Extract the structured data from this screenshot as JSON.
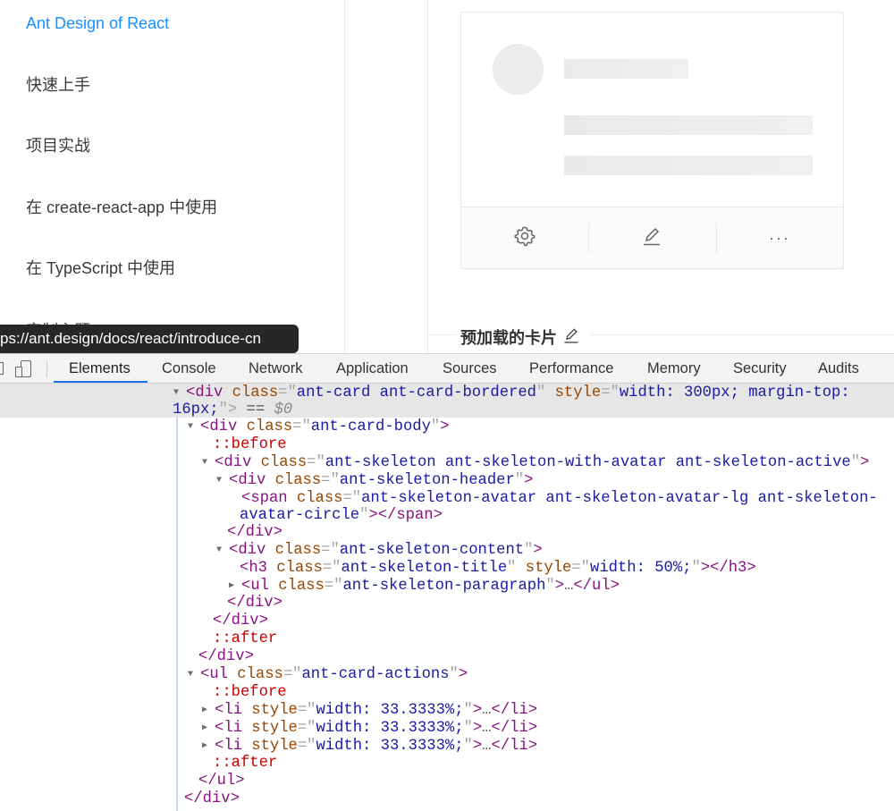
{
  "sidebar": {
    "items": [
      {
        "label": "Ant Design of React",
        "active": true
      },
      {
        "label": "快速上手"
      },
      {
        "label": "项目实战"
      },
      {
        "label": "在 create-react-app 中使用"
      },
      {
        "label": "在 TypeScript 中使用"
      },
      {
        "label": "定制主题"
      }
    ]
  },
  "tooltip": {
    "url": "ps://ant.design/docs/react/introduce-cn"
  },
  "card": {
    "actions": [
      "setting-icon",
      "edit-icon",
      "ellipsis-icon"
    ],
    "ellipsis": "···"
  },
  "section": {
    "title": "预加载的卡片"
  },
  "devtools": {
    "tabs": [
      "Elements",
      "Console",
      "Network",
      "Application",
      "Sources",
      "Performance",
      "Memory",
      "Security",
      "Audits"
    ],
    "active_tab": "Elements",
    "lines": [
      {
        "tri": "open",
        "tokens": [
          [
            "tag",
            "<div "
          ],
          [
            "attr",
            "class"
          ],
          [
            "punc",
            "=\""
          ],
          [
            "val",
            "ant-card ant-card-bordered"
          ],
          [
            "punc",
            "\" "
          ],
          [
            "attr",
            "style"
          ],
          [
            "punc",
            "=\""
          ],
          [
            "val",
            "width: 300px; margin-top:"
          ]
        ]
      },
      {
        "tokens": [
          [
            "val",
            "16px;"
          ],
          [
            "punc",
            "\">"
          ],
          [
            "plain",
            " == "
          ],
          [
            "ref",
            "$0"
          ]
        ]
      },
      {
        "tri": "open",
        "tokens": [
          [
            "tag",
            "<div "
          ],
          [
            "attr",
            "class"
          ],
          [
            "punc",
            "=\""
          ],
          [
            "val",
            "ant-card-body"
          ],
          [
            "punc",
            "\""
          ],
          [
            "tag",
            ">"
          ]
        ]
      },
      {
        "tokens": [
          [
            "pseudo",
            "::before"
          ]
        ]
      },
      {
        "tri": "open",
        "tokens": [
          [
            "tag",
            "<div "
          ],
          [
            "attr",
            "class"
          ],
          [
            "punc",
            "=\""
          ],
          [
            "val",
            "ant-skeleton ant-skeleton-with-avatar ant-skeleton-active"
          ],
          [
            "punc",
            "\""
          ],
          [
            "tag",
            ">"
          ]
        ]
      },
      {
        "tri": "open",
        "tokens": [
          [
            "tag",
            "<div "
          ],
          [
            "attr",
            "class"
          ],
          [
            "punc",
            "=\""
          ],
          [
            "val",
            "ant-skeleton-header"
          ],
          [
            "punc",
            "\""
          ],
          [
            "tag",
            ">"
          ]
        ]
      },
      {
        "tokens": [
          [
            "tag",
            "<span "
          ],
          [
            "attr",
            "class"
          ],
          [
            "punc",
            "=\""
          ],
          [
            "val",
            "ant-skeleton-avatar ant-skeleton-avatar-lg ant-skeleton-"
          ]
        ]
      },
      {
        "tokens": [
          [
            "val",
            "avatar-circle"
          ],
          [
            "punc",
            "\""
          ],
          [
            "tag",
            "></span>"
          ]
        ]
      },
      {
        "tokens": [
          [
            "tag",
            "</div>"
          ]
        ]
      },
      {
        "tri": "open",
        "tokens": [
          [
            "tag",
            "<div "
          ],
          [
            "attr",
            "class"
          ],
          [
            "punc",
            "=\""
          ],
          [
            "val",
            "ant-skeleton-content"
          ],
          [
            "punc",
            "\""
          ],
          [
            "tag",
            ">"
          ]
        ]
      },
      {
        "tokens": [
          [
            "tag",
            "<h3 "
          ],
          [
            "attr",
            "class"
          ],
          [
            "punc",
            "=\""
          ],
          [
            "val",
            "ant-skeleton-title"
          ],
          [
            "punc",
            "\" "
          ],
          [
            "attr",
            "style"
          ],
          [
            "punc",
            "=\""
          ],
          [
            "val",
            "width: 50%;"
          ],
          [
            "punc",
            "\""
          ],
          [
            "tag",
            "></h3>"
          ]
        ]
      },
      {
        "tri": "closed",
        "tokens": [
          [
            "tag",
            "<ul "
          ],
          [
            "attr",
            "class"
          ],
          [
            "punc",
            "=\""
          ],
          [
            "val",
            "ant-skeleton-paragraph"
          ],
          [
            "punc",
            "\""
          ],
          [
            "tag",
            ">"
          ],
          [
            "plain",
            "…"
          ],
          [
            "tag",
            "</ul>"
          ]
        ]
      },
      {
        "tokens": [
          [
            "tag",
            "</div>"
          ]
        ]
      },
      {
        "tokens": [
          [
            "tag",
            "</div>"
          ]
        ]
      },
      {
        "tokens": [
          [
            "pseudo",
            "::after"
          ]
        ]
      },
      {
        "tokens": [
          [
            "tag",
            "</div>"
          ]
        ]
      },
      {
        "tri": "open",
        "tokens": [
          [
            "tag",
            "<ul "
          ],
          [
            "attr",
            "class"
          ],
          [
            "punc",
            "=\""
          ],
          [
            "val",
            "ant-card-actions"
          ],
          [
            "punc",
            "\""
          ],
          [
            "tag",
            ">"
          ]
        ]
      },
      {
        "tokens": [
          [
            "pseudo",
            "::before"
          ]
        ]
      },
      {
        "tri": "closed",
        "tokens": [
          [
            "tag",
            "<li "
          ],
          [
            "attr",
            "style"
          ],
          [
            "punc",
            "=\""
          ],
          [
            "val",
            "width: 33.3333%;"
          ],
          [
            "punc",
            "\""
          ],
          [
            "tag",
            ">"
          ],
          [
            "plain",
            "…"
          ],
          [
            "tag",
            "</li>"
          ]
        ]
      },
      {
        "tri": "closed",
        "tokens": [
          [
            "tag",
            "<li "
          ],
          [
            "attr",
            "style"
          ],
          [
            "punc",
            "=\""
          ],
          [
            "val",
            "width: 33.3333%;"
          ],
          [
            "punc",
            "\""
          ],
          [
            "tag",
            ">"
          ],
          [
            "plain",
            "…"
          ],
          [
            "tag",
            "</li>"
          ]
        ]
      },
      {
        "tri": "closed",
        "tokens": [
          [
            "tag",
            "<li "
          ],
          [
            "attr",
            "style"
          ],
          [
            "punc",
            "=\""
          ],
          [
            "val",
            "width: 33.3333%;"
          ],
          [
            "punc",
            "\""
          ],
          [
            "tag",
            ">"
          ],
          [
            "plain",
            "…"
          ],
          [
            "tag",
            "</li>"
          ]
        ]
      },
      {
        "tokens": [
          [
            "pseudo",
            "::after"
          ]
        ]
      },
      {
        "tokens": [
          [
            "tag",
            "</ul>"
          ]
        ]
      },
      {
        "tokens": [
          [
            "tag",
            "</div>"
          ]
        ]
      }
    ]
  }
}
